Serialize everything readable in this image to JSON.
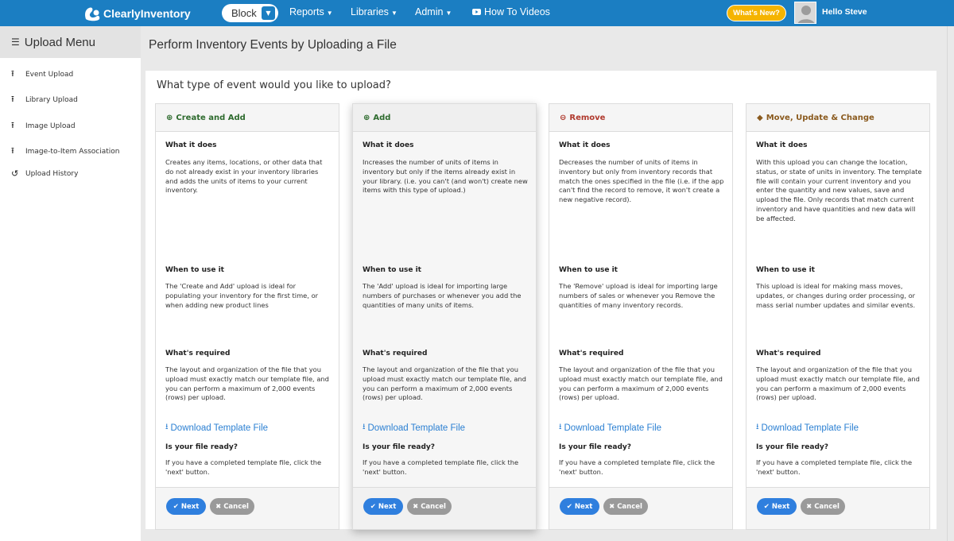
{
  "header": {
    "logo_text": "ClearlyInventory",
    "block_label": "Block",
    "nav": [
      {
        "label": "Reports"
      },
      {
        "label": "Libraries"
      },
      {
        "label": "Admin"
      },
      {
        "label": "How To Videos"
      }
    ],
    "whats_new": "What's New?",
    "user": "Hello Steve"
  },
  "sidebar": {
    "title": "Upload Menu",
    "items": [
      {
        "label": "Event Upload",
        "icon": "upload-icon"
      },
      {
        "label": "Library Upload",
        "icon": "upload-icon"
      },
      {
        "label": "Image Upload",
        "icon": "upload-icon"
      },
      {
        "label": "Image-to-Item Association",
        "icon": "upload-icon"
      },
      {
        "label": "Upload History",
        "icon": "history-icon"
      }
    ]
  },
  "main": {
    "title": "Perform Inventory Events by Uploading a File",
    "question": "What type of event would you like to upload?",
    "cards": [
      {
        "title": "Create and Add",
        "icon": "plus-circle-icon",
        "color": "#2e6b2e",
        "what_label": "What it does",
        "what_text": "Creates any items, locations, or other data that do not already exist in your inventory libraries and adds the units of items to your current inventory.",
        "when_label": "When to use it",
        "when_text": "The 'Create and Add' upload is ideal for populating your inventory for the first time, or when adding new product lines",
        "req_label": "What's required",
        "req_text": "The layout and organization of the file that you upload must exactly match our template file, and you can perform a maximum of 2,000 events (rows) per upload.",
        "download": "Download Template File",
        "ready_label": "Is your file ready?",
        "ready_text": "If you have a completed template file, click the 'next' button.",
        "next": "Next",
        "cancel": "Cancel"
      },
      {
        "title": "Add",
        "icon": "plus-circle-icon",
        "color": "#2e6b2e",
        "what_label": "What it does",
        "what_text": "Increases the number of units of items in inventory but only if the items already exist in your library. (i.e. you can't (and won't) create new items with this type of upload.)",
        "when_label": "When to use it",
        "when_text": "The 'Add' upload is ideal for importing large numbers of purchases or whenever you add the quantities of many units of items.",
        "req_label": "What's required",
        "req_text": "The layout and organization of the file that you upload must exactly match our template file, and you can perform a maximum of 2,000 events (rows) per upload.",
        "download": "Download Template File",
        "ready_label": "Is your file ready?",
        "ready_text": "If you have a completed template file, click the 'next' button.",
        "next": "Next",
        "cancel": "Cancel"
      },
      {
        "title": "Remove",
        "icon": "minus-circle-icon",
        "color": "#b03a2e",
        "what_label": "What it does",
        "what_text": "Decreases the number of units of items in inventory but only from inventory records that match the ones specified in the file (i.e. if the app can't find the record to remove, it won't create a new negative record).",
        "when_label": "When to use it",
        "when_text": "The 'Remove' upload is ideal for importing large numbers of sales or whenever you Remove the quantities of many inventory records.",
        "req_label": "What's required",
        "req_text": "The layout and organization of the file that you upload must exactly match our template file, and you can perform a maximum of 2,000 events (rows) per upload.",
        "download": "Download Template File",
        "ready_label": "Is your file ready?",
        "ready_text": "If you have a completed template file, click the 'next' button.",
        "next": "Next",
        "cancel": "Cancel"
      },
      {
        "title": "Move, Update & Change",
        "icon": "tag-icon",
        "color": "#8a5a1e",
        "what_label": "What it does",
        "what_text": "With this upload you can change the location, status, or state of units in inventory. The template file will contain your current inventory and you enter the quantity and new values, save and upload the file. Only records that match current inventory and have quantities and new data will be affected.",
        "when_label": "When to use it",
        "when_text": "This upload is ideal for making mass moves, updates, or changes during order processing, or mass serial number updates and similar events.",
        "req_label": "What's required",
        "req_text": "The layout and organization of the file that you upload must exactly match our template file, and you can perform a maximum of 2,000 events (rows) per upload.",
        "download": "Download Template File",
        "ready_label": "Is your file ready?",
        "ready_text": "If you have a completed template file, click the 'next' button.",
        "next": "Next",
        "cancel": "Cancel"
      }
    ]
  },
  "colors": {
    "topbar": "#1b7ec2",
    "accent": "#2f7fde",
    "whats_new": "#f5b400",
    "cancel": "#9a9a9a"
  }
}
